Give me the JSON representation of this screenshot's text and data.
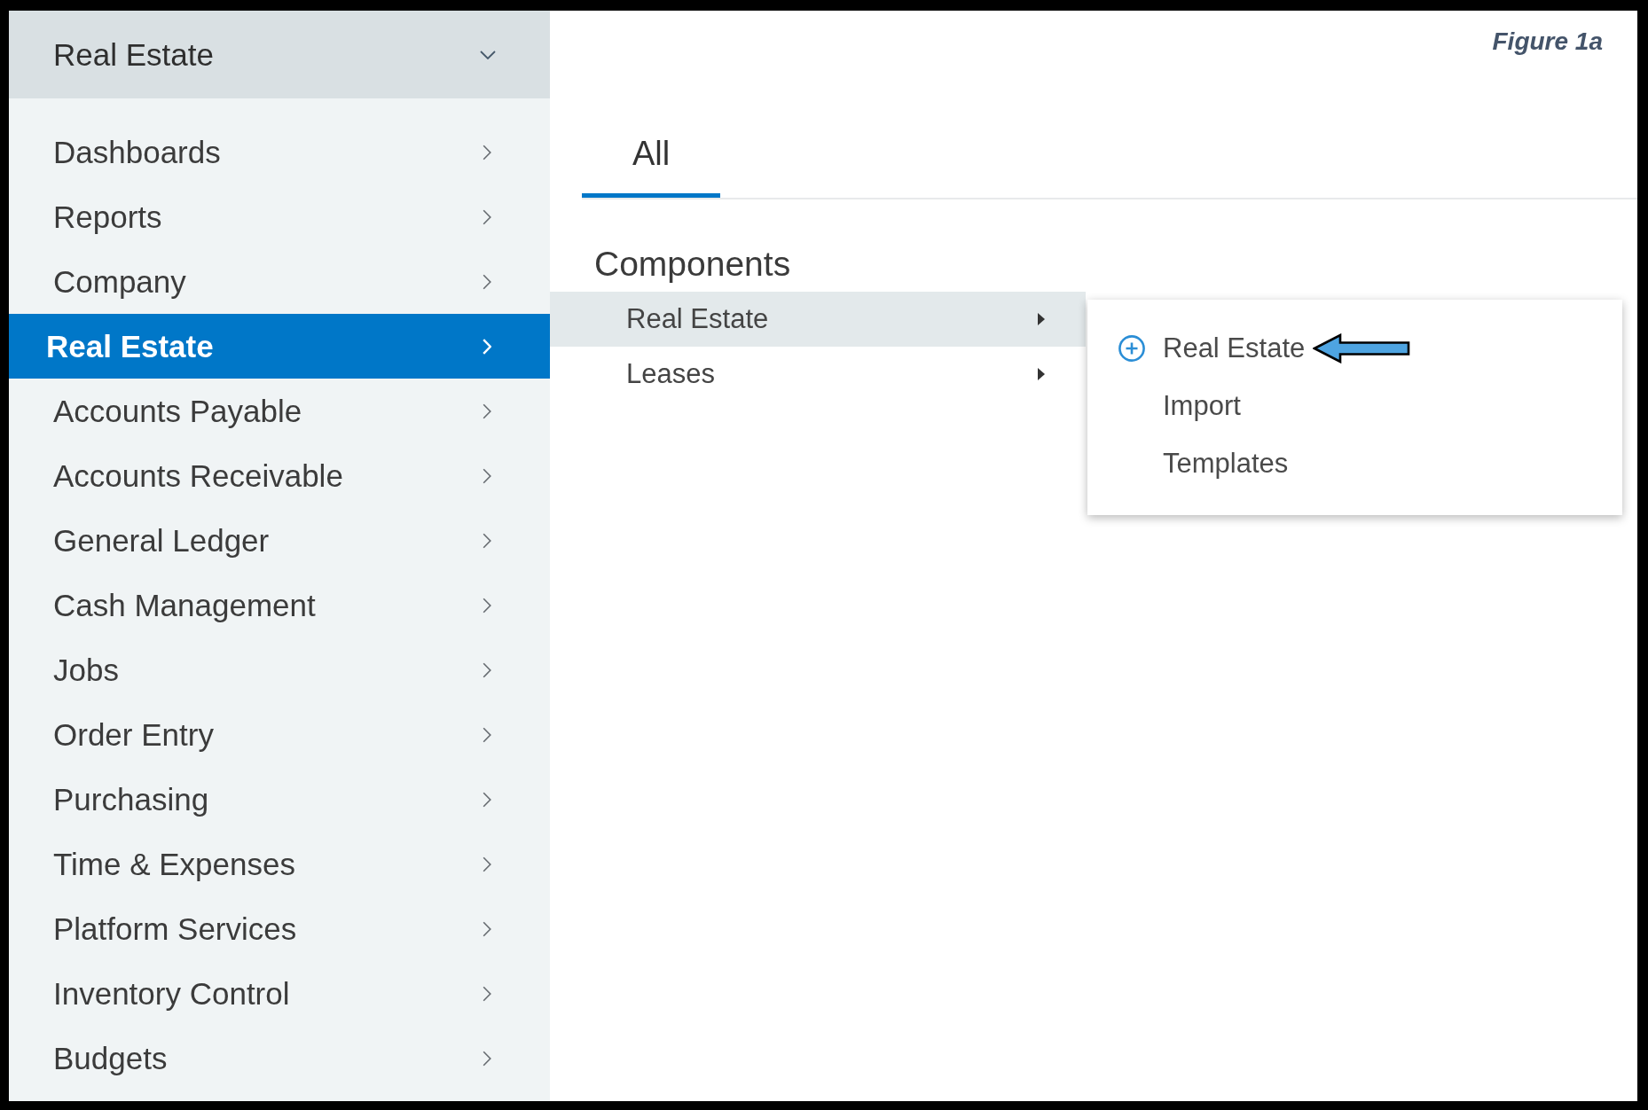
{
  "figure_label": "Figure 1a",
  "sidebar": {
    "module_selector": "Real Estate",
    "items": [
      {
        "label": "Dashboards",
        "selected": false
      },
      {
        "label": "Reports",
        "selected": false
      },
      {
        "label": "Company",
        "selected": false
      },
      {
        "label": "Real Estate",
        "selected": true
      },
      {
        "label": "Accounts Payable",
        "selected": false
      },
      {
        "label": "Accounts Receivable",
        "selected": false
      },
      {
        "label": "General Ledger",
        "selected": false
      },
      {
        "label": "Cash Management",
        "selected": false
      },
      {
        "label": "Jobs",
        "selected": false
      },
      {
        "label": "Order Entry",
        "selected": false
      },
      {
        "label": "Purchasing",
        "selected": false
      },
      {
        "label": "Time & Expenses",
        "selected": false
      },
      {
        "label": "Platform Services",
        "selected": false
      },
      {
        "label": "Inventory Control",
        "selected": false
      },
      {
        "label": "Budgets",
        "selected": false
      }
    ]
  },
  "tabs": [
    {
      "label": "All",
      "selected": true
    }
  ],
  "components": {
    "heading": "Components",
    "items": [
      {
        "label": "Real Estate",
        "selected": true
      },
      {
        "label": "Leases",
        "selected": false
      }
    ]
  },
  "flyout_menu": {
    "items": [
      {
        "label": "Real Estate",
        "kind": "add",
        "callout": true
      },
      {
        "label": "Import",
        "kind": "plain",
        "callout": false
      },
      {
        "label": "Templates",
        "kind": "plain",
        "callout": false
      }
    ]
  }
}
